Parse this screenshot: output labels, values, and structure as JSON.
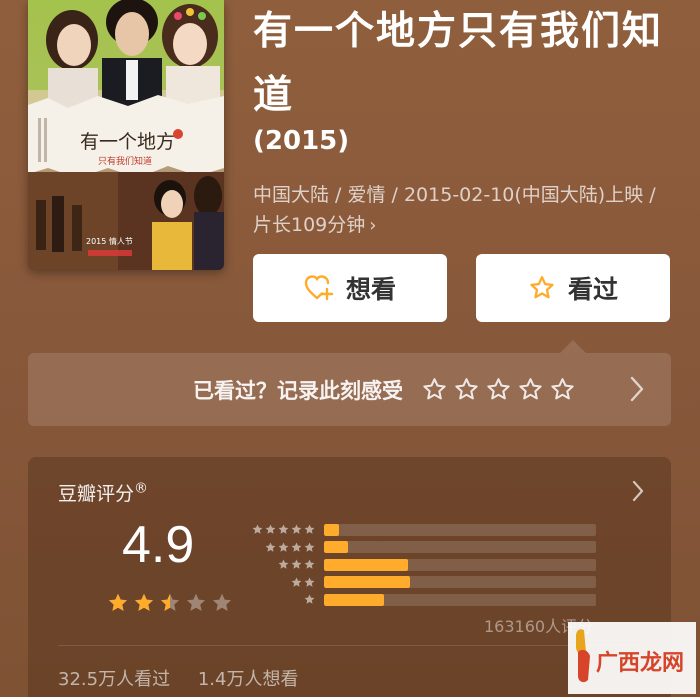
{
  "movie": {
    "title": "有一个地方只有我们知道",
    "year": "(2015)",
    "meta": "中国大陆 / 爱情 / 2015-02-10(中国大陆)上映 / 片长109分钟",
    "meta_chevron": "›"
  },
  "poster": {
    "title_text": "有一个地方",
    "subtitle_text": "只有我们知道",
    "date_text": "2015 情人节"
  },
  "actions": {
    "want_label": "想看",
    "seen_label": "看过"
  },
  "rate_prompt": {
    "text": "已看过？记录此刻感受",
    "star_count": 5
  },
  "rating": {
    "title": "豆瓣评分",
    "registered_mark": "®",
    "score": "4.9",
    "score_stars": 2.5,
    "distribution": [
      {
        "stars": 5,
        "fraction": 0.055
      },
      {
        "stars": 4,
        "fraction": 0.09
      },
      {
        "stars": 3,
        "fraction": 0.31
      },
      {
        "stars": 2,
        "fraction": 0.315
      },
      {
        "stars": 1,
        "fraction": 0.22
      }
    ],
    "count_text": "163160人评分",
    "seen_text": "32.5万人看过",
    "want_text": "1.4万人想看"
  },
  "watermark": {
    "text": "广西龙网"
  },
  "colors": {
    "background": "#8a5a3a",
    "accent_orange": "#ffac2d",
    "button_bg": "#ffffff",
    "button_text": "#333333"
  },
  "icons": {
    "want": "heart-plus-icon",
    "seen": "star-outline-icon",
    "chevron": "chevron-right-icon"
  }
}
